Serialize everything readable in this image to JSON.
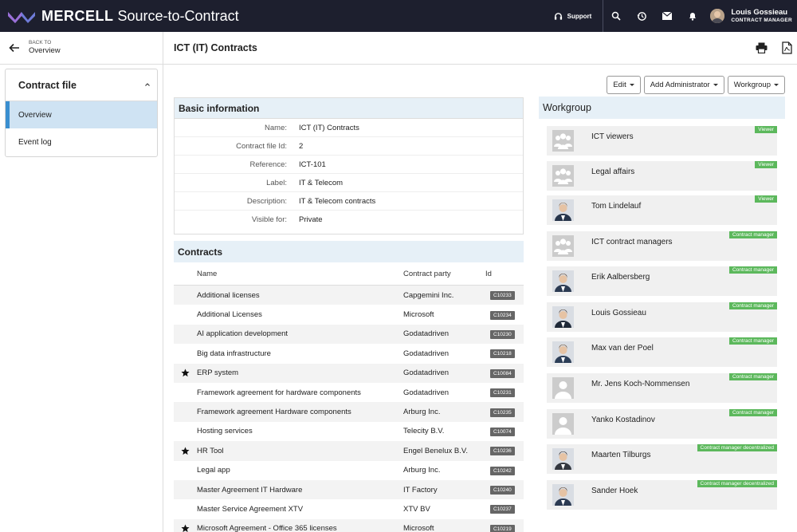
{
  "app": {
    "brand_bold": "MERCELL",
    "brand_rest": "Source-to-Contract",
    "support_label": "Support",
    "user_name": "Louis Gossieau",
    "user_role": "CONTRACT MANAGER"
  },
  "back": {
    "small": "BACK TO",
    "label": "Overview"
  },
  "page_title": "ICT (IT) Contracts",
  "sidebar": {
    "title": "Contract file",
    "items": [
      {
        "label": "Overview",
        "active": true
      },
      {
        "label": "Event log",
        "active": false
      }
    ]
  },
  "buttons": {
    "edit": "Edit",
    "add_admin": "Add Administrator",
    "workgroup": "Workgroup"
  },
  "basic_info": {
    "title": "Basic information",
    "rows": [
      {
        "label": "Name:",
        "value": "ICT (IT) Contracts"
      },
      {
        "label": "Contract file Id:",
        "value": "2"
      },
      {
        "label": "Reference:",
        "value": "ICT-101"
      },
      {
        "label": "Label:",
        "value": "IT & Telecom"
      },
      {
        "label": "Description:",
        "value": "IT & Telecom contracts"
      },
      {
        "label": "Visible for:",
        "value": "Private"
      }
    ]
  },
  "contracts": {
    "title": "Contracts",
    "columns": [
      "Name",
      "Contract party",
      "Id"
    ],
    "rows": [
      {
        "star": false,
        "name": "Additional licenses",
        "party": "Capgemini Inc.",
        "id": "C10233"
      },
      {
        "star": false,
        "name": "Additional Licenses",
        "party": "Microsoft",
        "id": "C10234"
      },
      {
        "star": false,
        "name": "AI application development",
        "party": "Godatadriven",
        "id": "C10230"
      },
      {
        "star": false,
        "name": "Big data infrastructure",
        "party": "Godatadriven",
        "id": "C10218"
      },
      {
        "star": true,
        "name": "ERP system",
        "party": "Godatadriven",
        "id": "C10084"
      },
      {
        "star": false,
        "name": "Framework agreement for hardware components",
        "party": "Godatadriven",
        "id": "C10231"
      },
      {
        "star": false,
        "name": "Framework agreement Hardware components",
        "party": "Arburg Inc.",
        "id": "C10235"
      },
      {
        "star": false,
        "name": "Hosting services",
        "party": "Telecity B.V.",
        "id": "C10074"
      },
      {
        "star": true,
        "name": "HR Tool",
        "party": "Engel Benelux B.V.",
        "id": "C10236"
      },
      {
        "star": false,
        "name": "Legal app",
        "party": "Arburg Inc.",
        "id": "C10242"
      },
      {
        "star": false,
        "name": "Master Agreement IT Hardware",
        "party": "IT Factory",
        "id": "C10240"
      },
      {
        "star": false,
        "name": "Master Service Agreement XTV",
        "party": "XTV BV",
        "id": "C10237"
      },
      {
        "star": true,
        "name": "Microsoft Agreement - Office 365 licenses",
        "party": "Microsoft",
        "id": "C10219"
      }
    ]
  },
  "workgroup": {
    "title": "Workgroup",
    "members": [
      {
        "name": "ICT viewers",
        "role": "Viewer",
        "avatar": "group-icon"
      },
      {
        "name": "Legal affairs",
        "role": "Viewer",
        "avatar": "group-icon"
      },
      {
        "name": "Tom Lindelauf",
        "role": "Viewer",
        "avatar": "photo"
      },
      {
        "name": "ICT contract managers",
        "role": "Contract manager",
        "avatar": "group-icon"
      },
      {
        "name": "Erik Aalbersberg",
        "role": "Contract manager",
        "avatar": "photo"
      },
      {
        "name": "Louis Gossieau",
        "role": "Contract manager",
        "avatar": "photo"
      },
      {
        "name": "Max van der Poel",
        "role": "Contract manager",
        "avatar": "photo"
      },
      {
        "name": "Mr. Jens Koch-Nommensen",
        "role": "Contract manager",
        "avatar": "person-placeholder-icon"
      },
      {
        "name": "Yanko Kostadinov",
        "role": "Contract manager",
        "avatar": "person-placeholder-icon"
      },
      {
        "name": "Maarten Tilburgs",
        "role": "Contract manager decentralized",
        "avatar": "photo"
      },
      {
        "name": "Sander Hoek",
        "role": "Contract manager decentralized",
        "avatar": "photo"
      }
    ]
  },
  "colors": {
    "topbar": "#1d1f2e",
    "accent": "#3a8fd0",
    "active_bg": "#cfe3f3",
    "panel_head": "#e6f0f7",
    "role_badge": "#5cb85c",
    "id_badge": "#666666"
  }
}
